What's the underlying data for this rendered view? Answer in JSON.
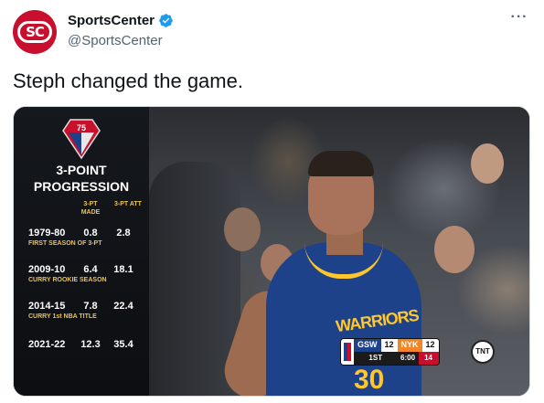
{
  "account": {
    "display_name": "SportsCenter",
    "handle": "@SportsCenter",
    "avatar_text": "SC",
    "brand_color": "#c8102e",
    "verified_icon": "verified-badge-icon"
  },
  "menu_icon": "more-options-icon",
  "tweet": {
    "text": "Steph changed the game."
  },
  "graphic": {
    "logo_text": "75",
    "title": "3-POINT PROGRESSION",
    "col_made": "3-PT MADE",
    "col_att": "3-PT ATT",
    "rows": [
      {
        "season": "1979-80",
        "made": "0.8",
        "att": "2.8",
        "note": "FIRST SEASON OF 3-PT"
      },
      {
        "season": "2009-10",
        "made": "6.4",
        "att": "18.1",
        "note": "CURRY ROOKIE SEASON"
      },
      {
        "season": "2014-15",
        "made": "7.8",
        "att": "22.4",
        "note": "CURRY 1st NBA TITLE"
      },
      {
        "season": "2021-22",
        "made": "12.3",
        "att": "35.4",
        "note": ""
      }
    ],
    "accent_color": "#e8c25b"
  },
  "jersey": {
    "word": "WARRIORS",
    "number": "30"
  },
  "scorebug": {
    "team1": "GSW",
    "score1": "12",
    "team1_color": "#1d428a",
    "team2": "NYK",
    "score2": "12",
    "team2_color": "#f58426",
    "period": "1ST",
    "clock": "6:00",
    "shot_clock": "14",
    "network": "TNT"
  }
}
